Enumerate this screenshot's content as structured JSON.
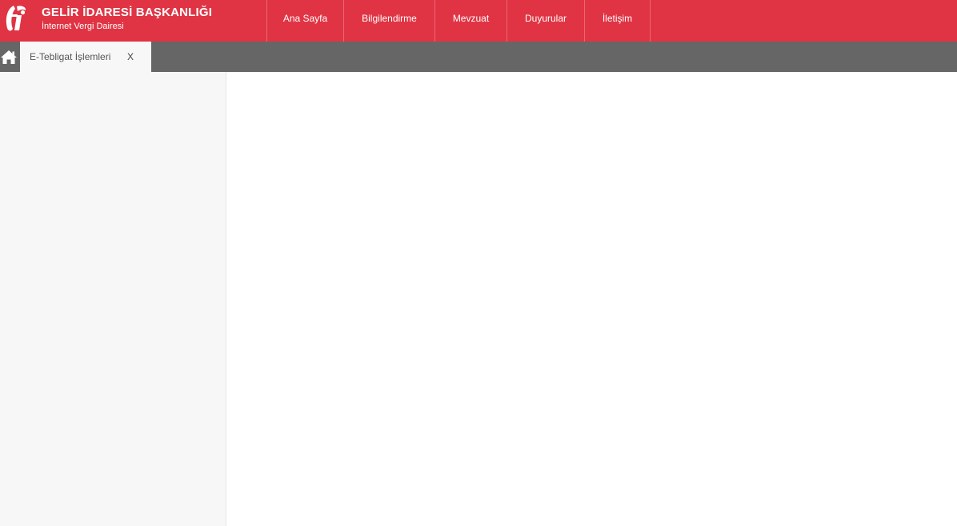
{
  "header": {
    "brand_title": "GELİR İDARESİ BAŞKANLIĞI",
    "brand_subtitle": "İnternet Vergi Dairesi",
    "logo_icon": "gib-logo-icon",
    "background_color": "#e03444"
  },
  "nav": {
    "items": [
      {
        "label": "Ana Sayfa"
      },
      {
        "label": "Bilgilendirme"
      },
      {
        "label": "Mevzuat"
      },
      {
        "label": "Duyurular"
      },
      {
        "label": "İletişim"
      }
    ]
  },
  "tabbar": {
    "home_icon": "home-icon",
    "background_color": "#666666",
    "tabs": [
      {
        "label": "E-Tebligat İşlemleri",
        "close_label": "X"
      }
    ]
  }
}
